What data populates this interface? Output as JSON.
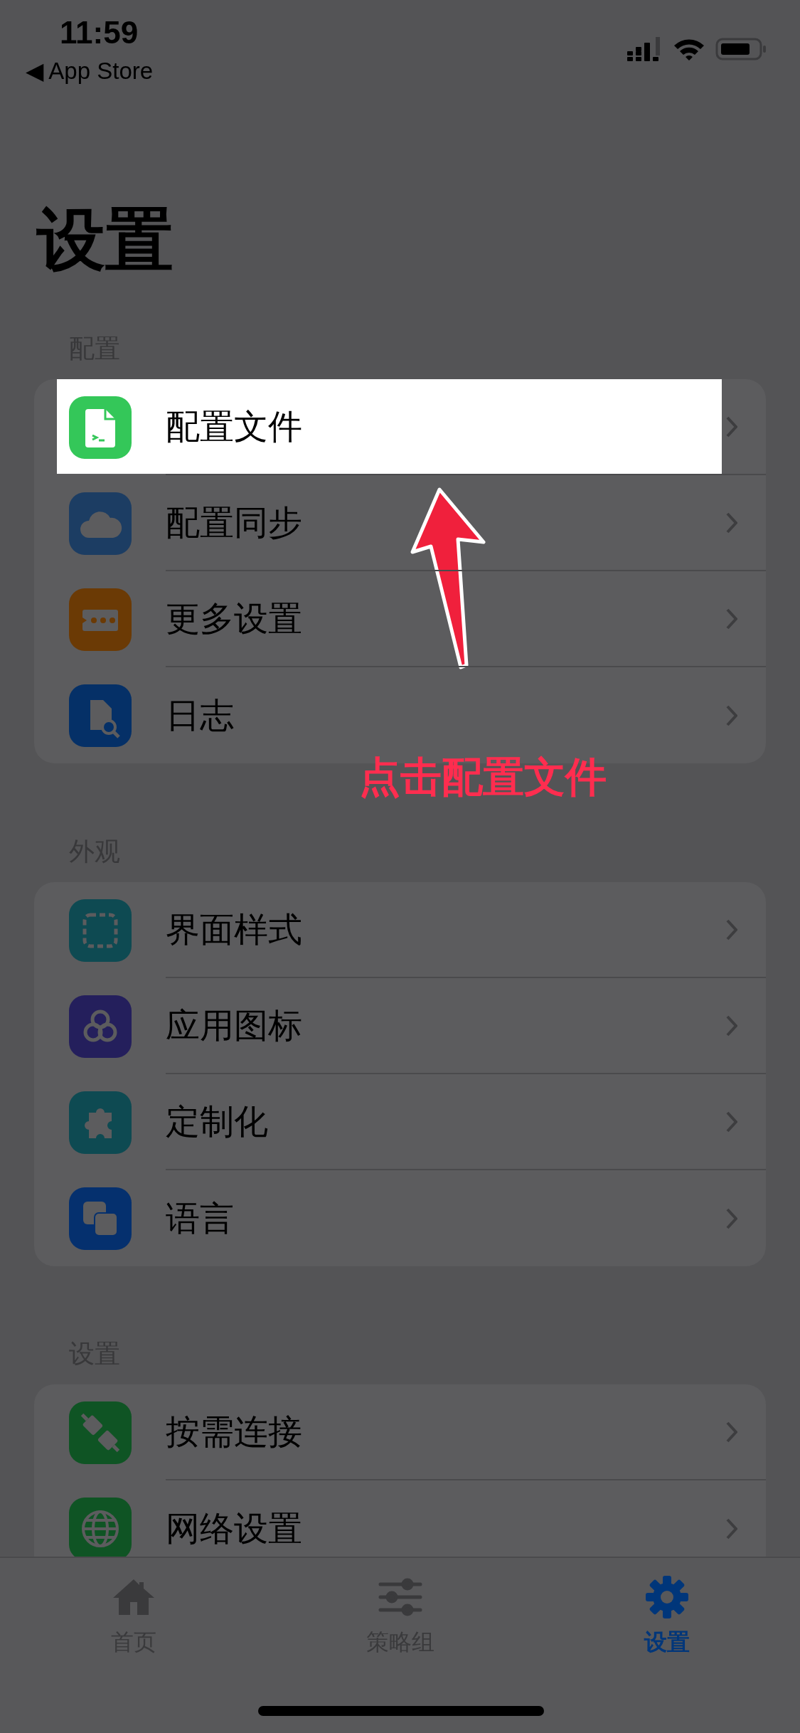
{
  "status_bar": {
    "time": "11:59",
    "back": "◀ App Store"
  },
  "title": "设置",
  "sections": [
    {
      "header": "配置",
      "items": [
        {
          "label": "配置文件",
          "color": "#34c759",
          "highlighted": true
        },
        {
          "label": "配置同步",
          "color": "#1c3d63",
          "highlighted": false
        },
        {
          "label": "更多设置",
          "color": "#6b3a05",
          "highlighted": false
        },
        {
          "label": "日志",
          "color": "#053067",
          "highlighted": false
        }
      ]
    },
    {
      "header": "外观",
      "items": [
        {
          "label": "界面样式",
          "color": "#0e4a52",
          "highlighted": false
        },
        {
          "label": "应用图标",
          "color": "#241f5c",
          "highlighted": false
        },
        {
          "label": "定制化",
          "color": "#0e4a52",
          "highlighted": false
        },
        {
          "label": "语言",
          "color": "#05306e",
          "highlighted": false
        }
      ]
    },
    {
      "header": "设置",
      "items": [
        {
          "label": "按需连接",
          "color": "#0f5424",
          "highlighted": false
        },
        {
          "label": "网络设置",
          "color": "#0f5424",
          "highlighted": false
        }
      ]
    }
  ],
  "annotation": {
    "text": "点击配置文件"
  },
  "tab_bar": [
    {
      "label": "首页",
      "selected": false
    },
    {
      "label": "策略组",
      "selected": false
    },
    {
      "label": "设置",
      "selected": true
    }
  ]
}
